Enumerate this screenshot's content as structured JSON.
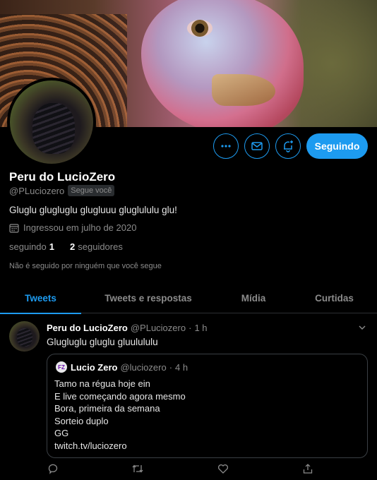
{
  "profile": {
    "name": "Peru do LucioZero",
    "handle": "@PLuciozero",
    "follows_you": "Segue você",
    "bio": "Gluglu glugluglu glugluuu gluglululu glu!",
    "joined": "Ingressou em julho de 2020",
    "following_label": "seguindo",
    "following_count": "1",
    "followers_count": "2",
    "followers_label": "seguidores",
    "not_followed_note": "Não é seguido por ninguém que você segue"
  },
  "actions": {
    "more_icon": "more-icon",
    "message_icon": "mail-icon",
    "notify_icon": "bell-plus-icon",
    "following_button": "Seguindo"
  },
  "tabs": [
    {
      "label": "Tweets",
      "active": true
    },
    {
      "label": "Tweets e respostas",
      "active": false
    },
    {
      "label": "Mídia",
      "active": false
    },
    {
      "label": "Curtidas",
      "active": false
    }
  ],
  "tweet": {
    "author": "Peru do LucioZero",
    "handle": "@PLuciozero",
    "sep": "·",
    "time": "1 h",
    "text": "Glugluglu gluglu gluulululu",
    "quote": {
      "author": "Lucio Zero",
      "handle": "@luciozero",
      "sep": "·",
      "time": "4 h",
      "lines": [
        "Tamo na régua hoje ein",
        "E live começando agora mesmo",
        "Bora, primeira da semana",
        "Sorteio duplo",
        "GG",
        "twitch.tv/luciozero"
      ]
    }
  },
  "colors": {
    "accent": "#1d9bf0",
    "background": "#000000",
    "muted": "#8b8b8b"
  }
}
